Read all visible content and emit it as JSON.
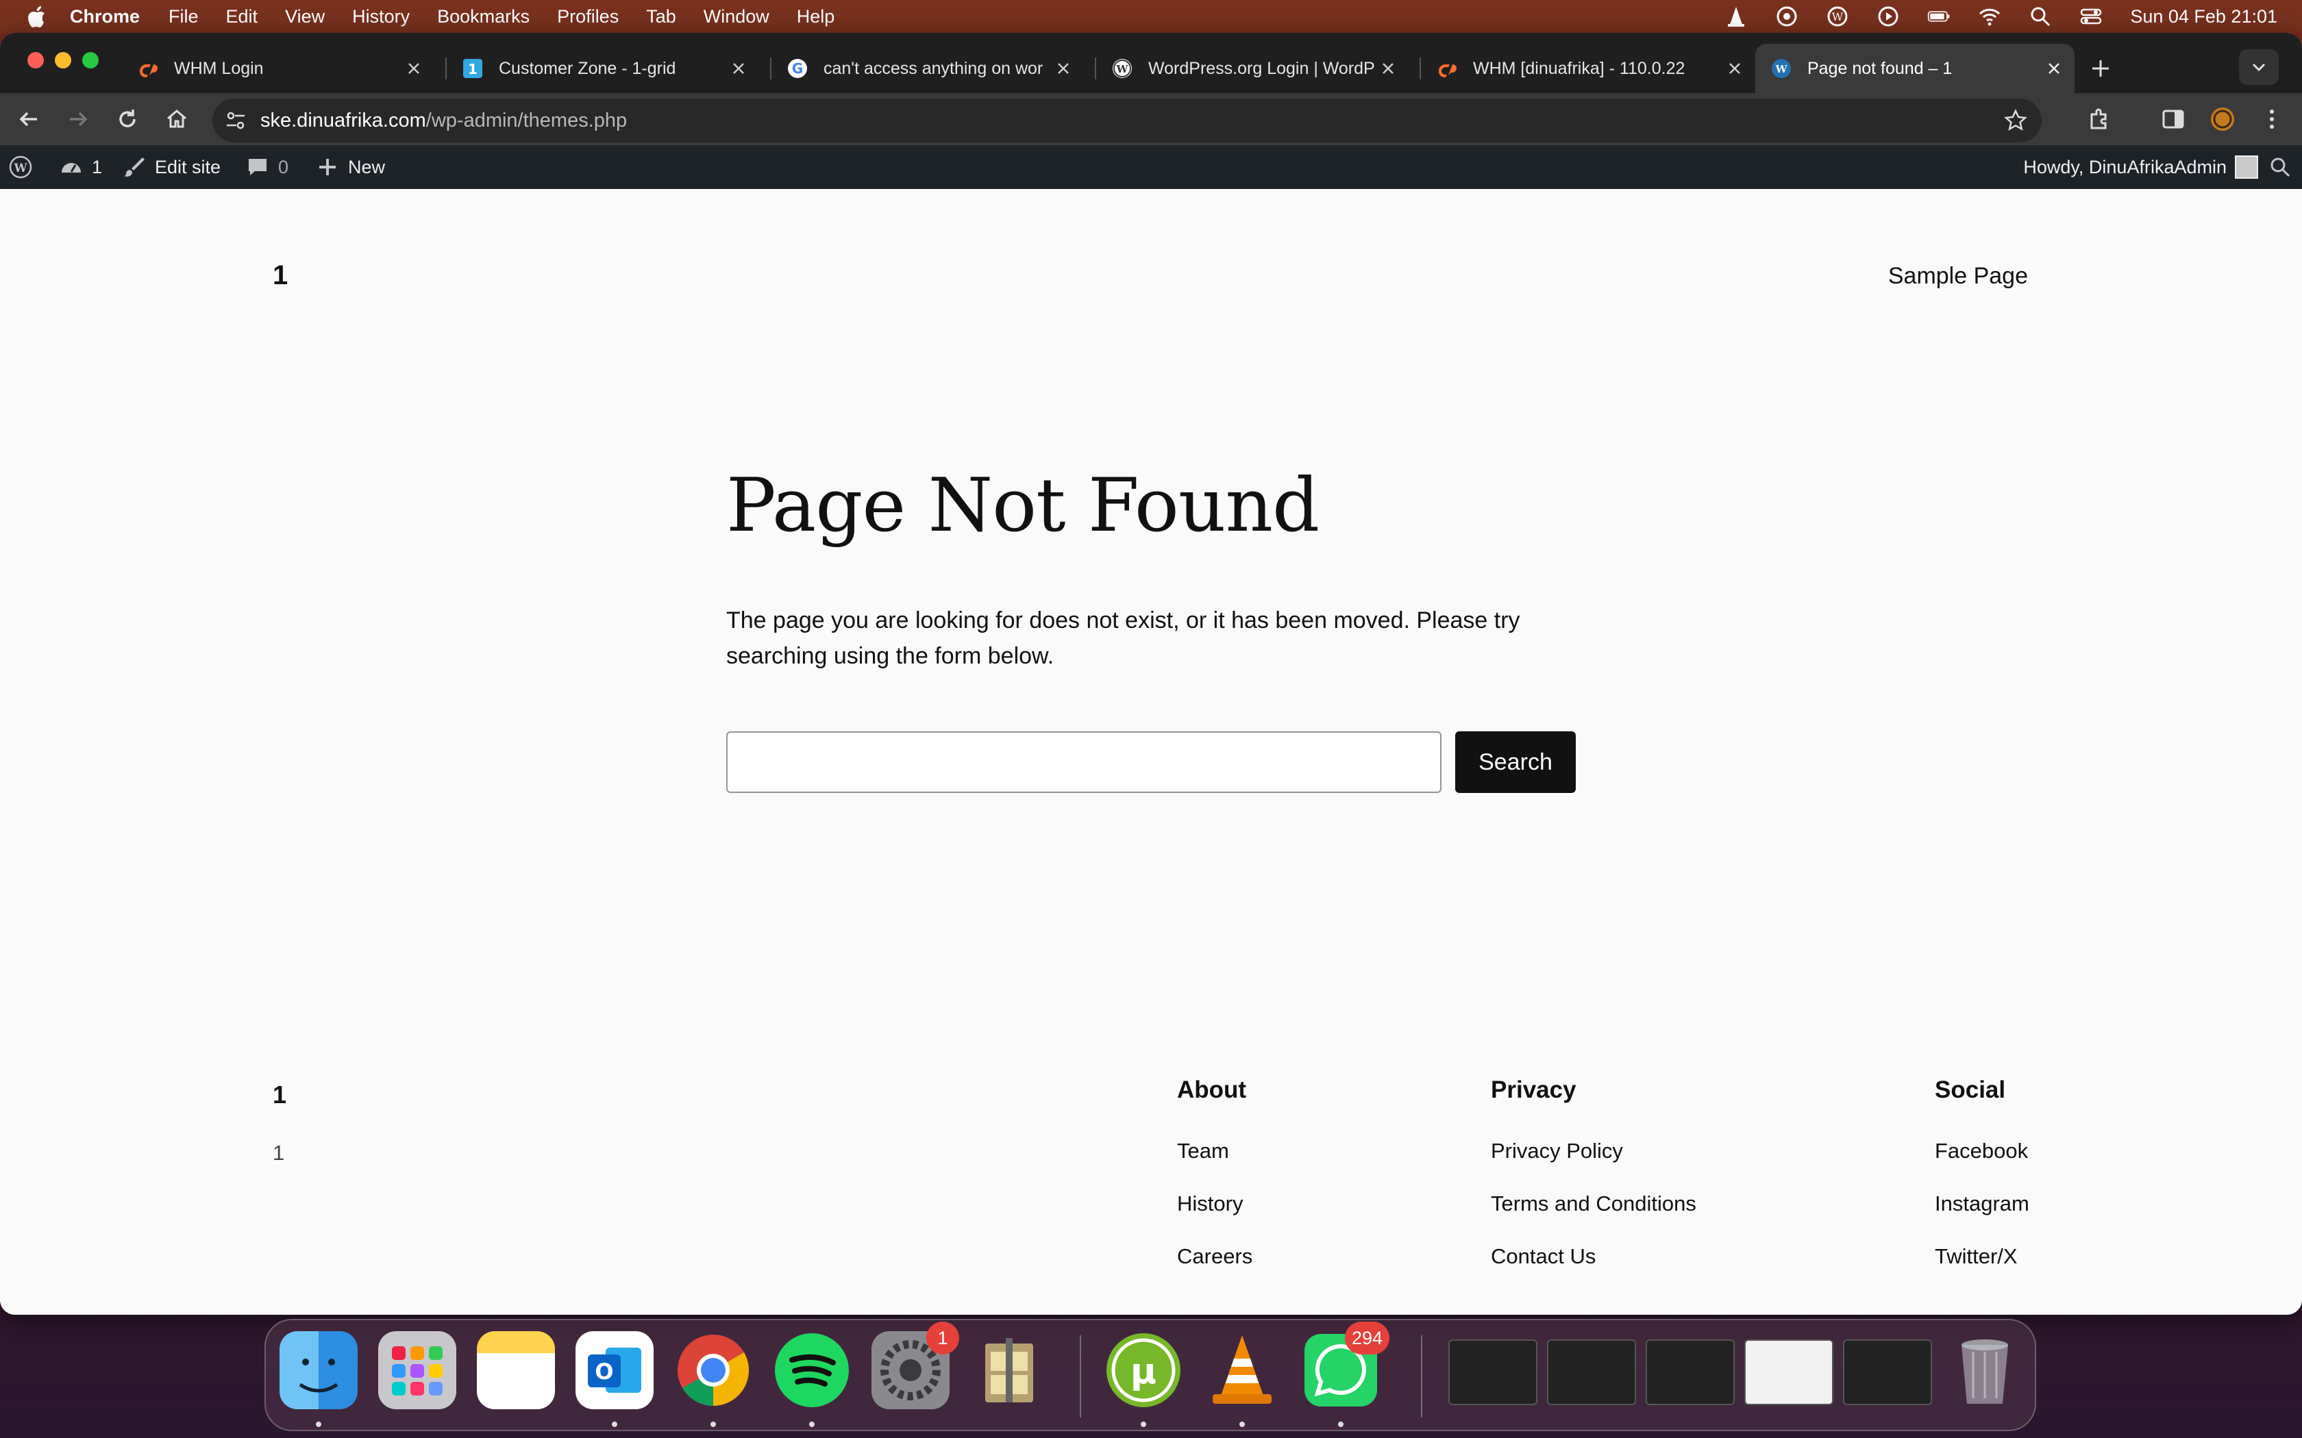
{
  "menubar": {
    "app_name": "Chrome",
    "items": [
      "File",
      "Edit",
      "View",
      "History",
      "Bookmarks",
      "Profiles",
      "Tab",
      "Window",
      "Help"
    ],
    "clock": "Sun 04 Feb  21:01"
  },
  "tabs": [
    {
      "title": "WHM Login",
      "icon": "cpanel-icon"
    },
    {
      "title": "Customer Zone - 1-grid",
      "icon": "onegrid-icon"
    },
    {
      "title": "can't access anything on wor",
      "icon": "google-icon"
    },
    {
      "title": "WordPress.org Login | WordP",
      "icon": "wordpress-icon"
    },
    {
      "title": "WHM [dinuafrika] - 110.0.22",
      "icon": "cpanel-icon"
    },
    {
      "title": "Page not found – 1",
      "icon": "wordpress-icon",
      "active": true
    }
  ],
  "omnibox": {
    "host": "ske.dinuafrika.com",
    "path": "/wp-admin/themes.php"
  },
  "adminbar": {
    "updates_count": "1",
    "edit_site": "Edit site",
    "comments_count": "0",
    "new_label": "New",
    "howdy": "Howdy, DinuAfrikaAdmin"
  },
  "site": {
    "title": "1",
    "nav_link": "Sample Page"
  },
  "main": {
    "heading": "Page Not Found",
    "message": "The page you are looking for does not exist, or it has been moved. Please try searching using the form below.",
    "search_value": "",
    "search_button": "Search"
  },
  "footer": {
    "title": "1",
    "tagline": "1",
    "columns": [
      {
        "heading": "About",
        "links": [
          "Team",
          "History",
          "Careers"
        ]
      },
      {
        "heading": "Privacy",
        "links": [
          "Privacy Policy",
          "Terms and Conditions",
          "Contact Us"
        ]
      },
      {
        "heading": "Social",
        "links": [
          "Facebook",
          "Instagram",
          "Twitter/X"
        ]
      }
    ]
  },
  "dock": {
    "system_settings_badge": "1",
    "whatsapp_badge": "294"
  },
  "colors": {
    "admin_bar": "#1d2327",
    "page_bg": "#fafafa",
    "button_bg": "#111111",
    "tab_strip": "#1f1f1f"
  }
}
